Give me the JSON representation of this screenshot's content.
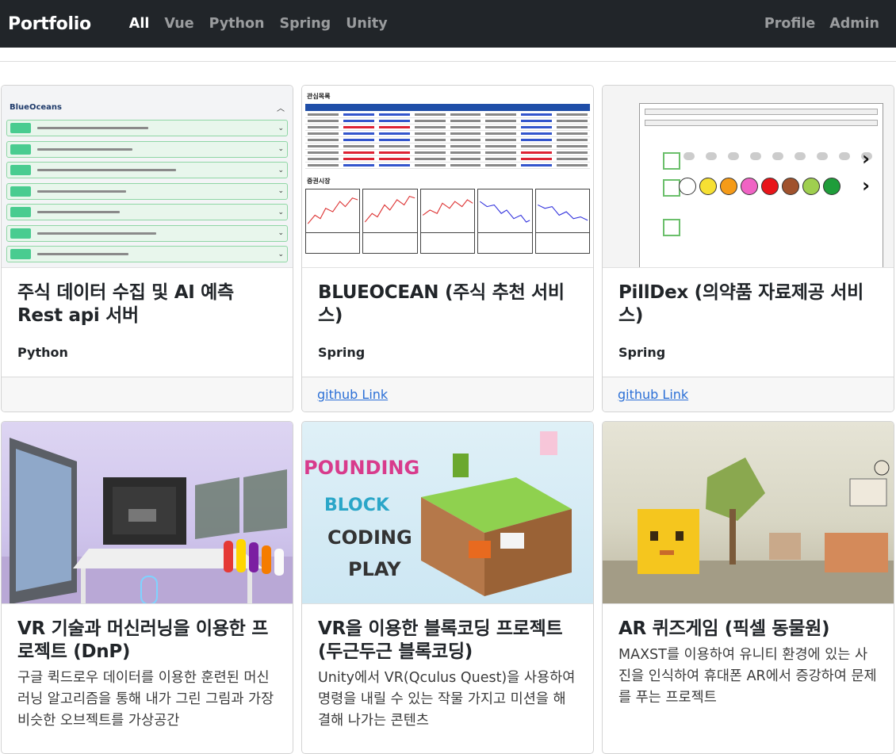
{
  "nav": {
    "brand": "Portfolio",
    "left": [
      "All",
      "Vue",
      "Python",
      "Spring",
      "Unity"
    ],
    "right": [
      "Profile",
      "Admin"
    ]
  },
  "cards": [
    {
      "title": "주식 데이터 수집 및 AI 예측 Rest api 서버",
      "tag": "Python",
      "text": "",
      "link": ""
    },
    {
      "title": "BLUEOCEAN (주식 추천 서비스)",
      "tag": "Spring",
      "text": "",
      "link": "github Link"
    },
    {
      "title": "PillDex (의약품 자료제공 서비스)",
      "tag": "Spring",
      "text": "",
      "link": "github Link"
    },
    {
      "title": "VR 기술과 머신러닝을 이용한 프로젝트 (DnP)",
      "tag": "",
      "text": "구글 퀵드로우 데이터를 이용한 훈련된 머신러닝 알고리즘을 통해 내가 그린 그림과 가장 비슷한 오브젝트를 가상공간",
      "link": ""
    },
    {
      "title": "VR을 이용한 블록코딩 프로젝트 (두근두근 블록코딩)",
      "tag": "",
      "text": "Unity에서 VR(Qculus Quest)을 사용하여 명령을 내릴 수 있는 작물 가지고 미션을 해결해 나가는 콘텐츠",
      "link": ""
    },
    {
      "title": "AR 퀴즈게임 (픽셀 동물원)",
      "tag": "",
      "text": "MAXST를 이용하여 유니티 환경에 있는 사진을 인식하여 휴대폰 AR에서 증강하여 문제를 푸는 프로젝트",
      "link": ""
    }
  ],
  "thumbs": {
    "api_logo": "BlueOceans",
    "stock_label_1": "관심목록",
    "stock_label_2": "증권시장",
    "game_text": [
      "POUNDING",
      "BLOCK",
      "CODING",
      "PLAY"
    ]
  }
}
